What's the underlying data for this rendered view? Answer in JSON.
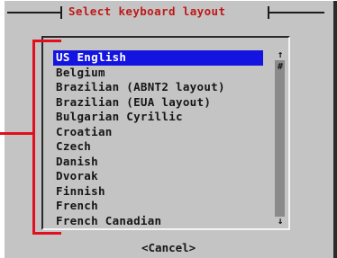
{
  "dialog": {
    "title": "Select keyboard layout",
    "items": [
      {
        "label": "US English",
        "selected": true
      },
      {
        "label": "Belgium",
        "selected": false
      },
      {
        "label": "Brazilian (ABNT2 layout)",
        "selected": false
      },
      {
        "label": "Brazilian (EUA layout)",
        "selected": false
      },
      {
        "label": "Bulgarian Cyrillic",
        "selected": false
      },
      {
        "label": "Croatian",
        "selected": false
      },
      {
        "label": "Czech",
        "selected": false
      },
      {
        "label": "Danish",
        "selected": false
      },
      {
        "label": "Dvorak",
        "selected": false
      },
      {
        "label": "Finnish",
        "selected": false
      },
      {
        "label": "French",
        "selected": false
      },
      {
        "label": "French Canadian",
        "selected": false
      }
    ],
    "scrollbar": {
      "up": "↑",
      "thumb": "#",
      "down": "↓"
    },
    "cancel_label": "<Cancel>"
  },
  "colors": {
    "background": "#c4c4c4",
    "title": "#c01818",
    "selection": "#1414e0",
    "annotation": "#e0101e"
  }
}
